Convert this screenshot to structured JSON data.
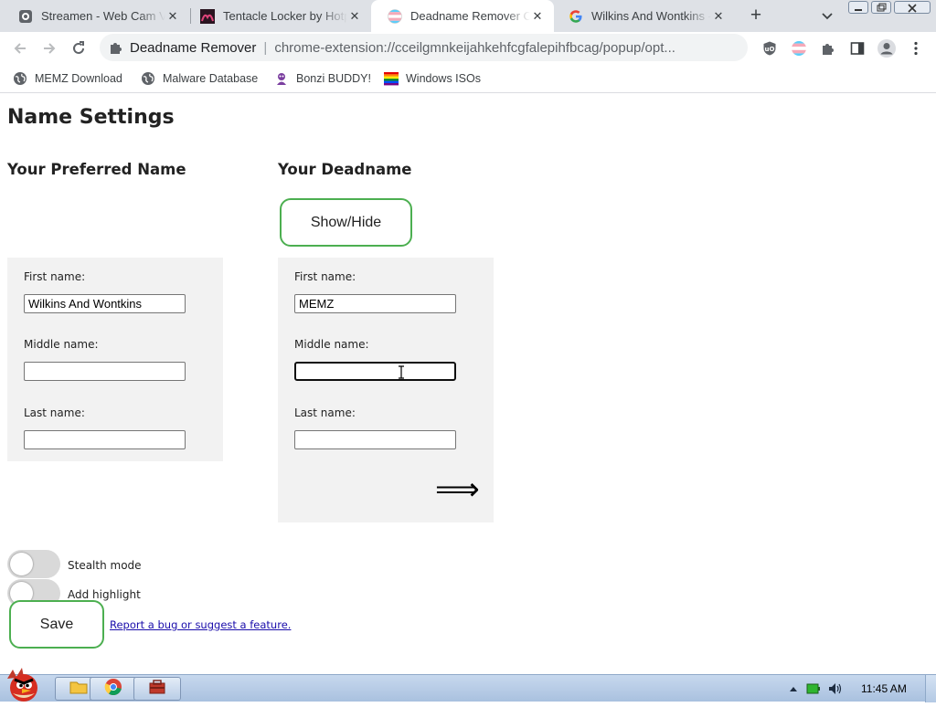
{
  "browser": {
    "tabs": [
      {
        "title": "Streamen - Web Cam Viewer",
        "icon": "camera-favicon"
      },
      {
        "title": "Tentacle Locker by Hotpotato",
        "icon": "game-favicon"
      },
      {
        "title": "Deadname Remover Options",
        "icon": "trans-flag-favicon"
      },
      {
        "title": "Wilkins And Wontkins - Google Search",
        "icon": "google-favicon"
      }
    ],
    "active_tab_index": 2,
    "omnibox": {
      "site_name": "Deadname Remover",
      "url": "chrome-extension://cceilgmnkeijahkehfcgfalepihfbcag/popup/opt..."
    },
    "bookmarks": [
      {
        "label": "MEMZ Download",
        "icon": "globe-icon"
      },
      {
        "label": "Malware Database",
        "icon": "globe-icon"
      },
      {
        "label": "Bonzi BUDDY!",
        "icon": "bonzi-icon"
      },
      {
        "label": "Windows ISOs",
        "icon": "windows-flag-icon"
      }
    ]
  },
  "page": {
    "title": "Name Settings",
    "preferred": {
      "heading": "Your Preferred Name",
      "first_label": "First name:",
      "first_value": "Wilkins And Wontkins",
      "middle_label": "Middle name:",
      "middle_value": "",
      "last_label": "Last name:",
      "last_value": ""
    },
    "deadname": {
      "heading": "Your Deadname",
      "show_hide_label": "Show/Hide",
      "first_label": "First name:",
      "first_value": "MEMZ",
      "middle_label": "Middle name:",
      "middle_value": "",
      "last_label": "Last name:",
      "last_value": "",
      "arrow": "⟹"
    },
    "toggles": {
      "stealth_label": "Stealth mode",
      "stealth_on": false,
      "highlight_label": "Add highlight",
      "highlight_on": false
    },
    "save_label": "Save",
    "report_link": "Report a bug or suggest a feature."
  },
  "taskbar": {
    "clock": "11:45 AM"
  },
  "colors": {
    "accent_green": "#4caf50",
    "panel_bg": "#f2f2f2",
    "tab_strip": "#dee1e6",
    "link": "#1a0dab"
  }
}
